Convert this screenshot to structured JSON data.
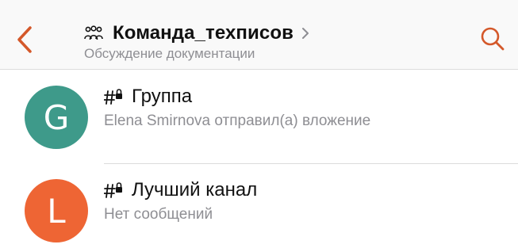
{
  "header": {
    "title": "Команда_техписов",
    "subtitle": "Обсуждение документации",
    "back_icon": "chevron-left-icon",
    "search_icon": "search-icon",
    "team_icon": "team-icon",
    "accent_color": "#d4582a"
  },
  "channels": [
    {
      "avatar_letter": "G",
      "avatar_color": "#3e9a8a",
      "name": "Группа",
      "preview": "Elena Smirnova отправил(а) вложение",
      "icon": "private-channel-icon"
    },
    {
      "avatar_letter": "L",
      "avatar_color": "#ee6534",
      "name": "Лучший канал",
      "preview": "Нет сообщений",
      "icon": "private-channel-icon"
    }
  ]
}
